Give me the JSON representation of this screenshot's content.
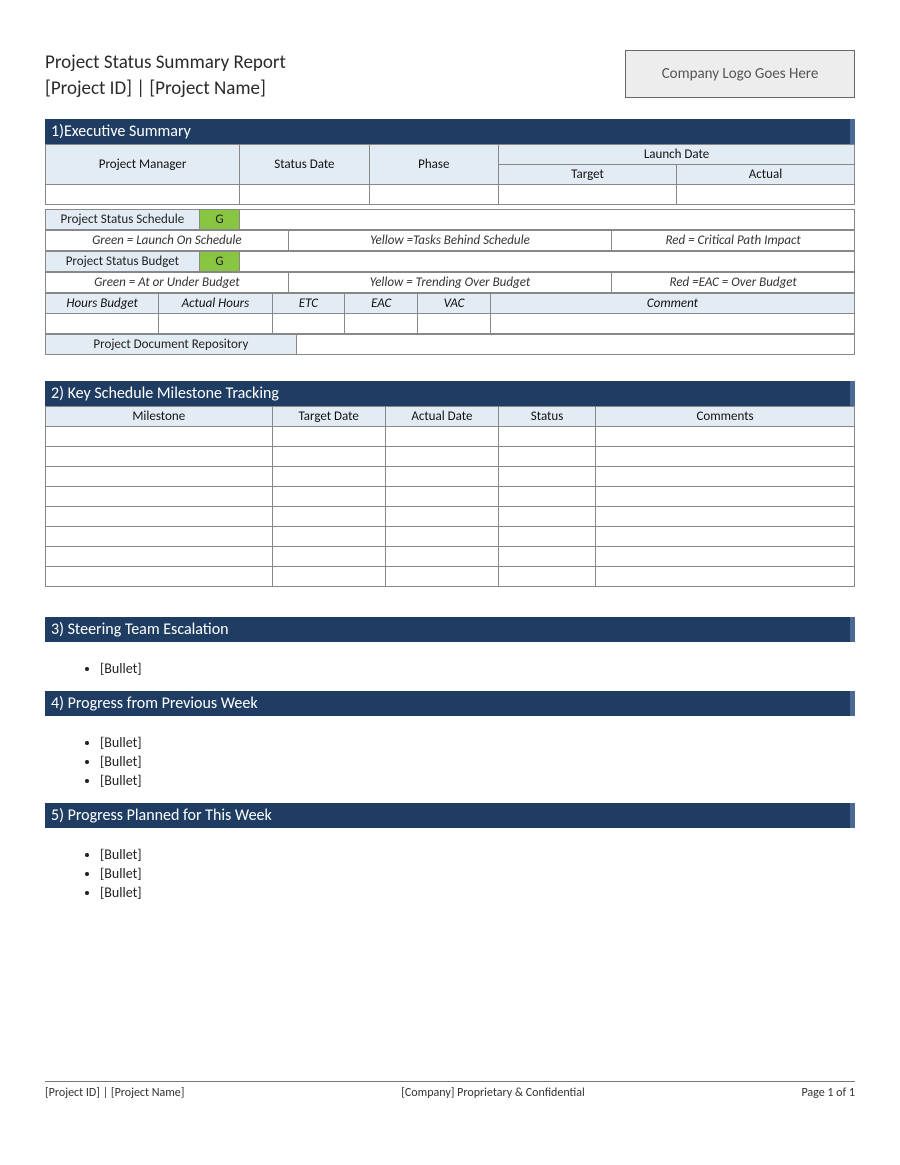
{
  "header": {
    "title": "Project Status Summary Report",
    "subtitle": "[Project ID] | [Project Name]",
    "logo_placeholder": "Company Logo Goes Here"
  },
  "sections": {
    "exec": "1)Executive Summary",
    "milestone": "2) Key Schedule Milestone Tracking",
    "escalation": "3) Steering Team Escalation",
    "progress_prev": "4) Progress from Previous Week",
    "progress_plan": "5) Progress Planned for This Week"
  },
  "exec": {
    "pm": "Project Manager",
    "status_date": "Status Date",
    "phase": "Phase",
    "launch_date": "Launch Date",
    "target": "Target",
    "actual": "Actual",
    "schedule_label": "Project Status Schedule",
    "budget_label": "Project Status Budget",
    "g1": "G",
    "g2": "G",
    "legend_schedule_green": "Green = Launch On Schedule",
    "legend_schedule_yellow": "Yellow =Tasks Behind Schedule",
    "legend_schedule_red": "Red = Critical Path Impact",
    "legend_budget_green": "Green = At or Under Budget",
    "legend_budget_yellow": "Yellow = Trending Over Budget",
    "legend_budget_red": "Red =EAC = Over Budget",
    "hours_budget": "Hours Budget",
    "actual_hours": "Actual Hours",
    "etc": "ETC",
    "eac": "EAC",
    "vac": "VAC",
    "comment": "Comment",
    "repo": "Project Document Repository"
  },
  "milestone": {
    "milestone": "Milestone",
    "target_date": "Target Date",
    "actual_date": "Actual Date",
    "status": "Status",
    "comments": "Comments"
  },
  "bullets": {
    "escalation": [
      "[Bullet]"
    ],
    "progress_prev": [
      "[Bullet]",
      "[Bullet]",
      "[Bullet]"
    ],
    "progress_plan": [
      "[Bullet]",
      "[Bullet]",
      "[Bullet]"
    ]
  },
  "footer": {
    "left": "[Project ID] | [Project Name]",
    "center": "[Company] Proprietary & Confidential",
    "right": "Page 1 of 1"
  }
}
